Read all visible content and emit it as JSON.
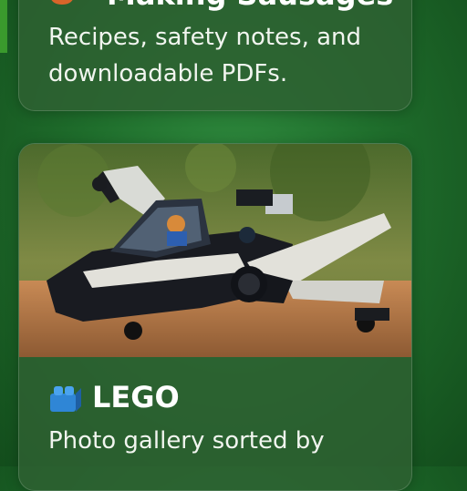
{
  "cards": [
    {
      "title": "Making Sausages",
      "icon": "sausage-icon",
      "description": "Recipes, safety notes, and downloadable PDFs."
    },
    {
      "title": "LEGO",
      "icon": "lego-brick-icon",
      "description": "Photo gallery sorted by",
      "image": "lego-spaceship-photo"
    }
  ],
  "colors": {
    "background": "#1f6e2c",
    "card": "#2e6032",
    "text": "#ffffff"
  }
}
